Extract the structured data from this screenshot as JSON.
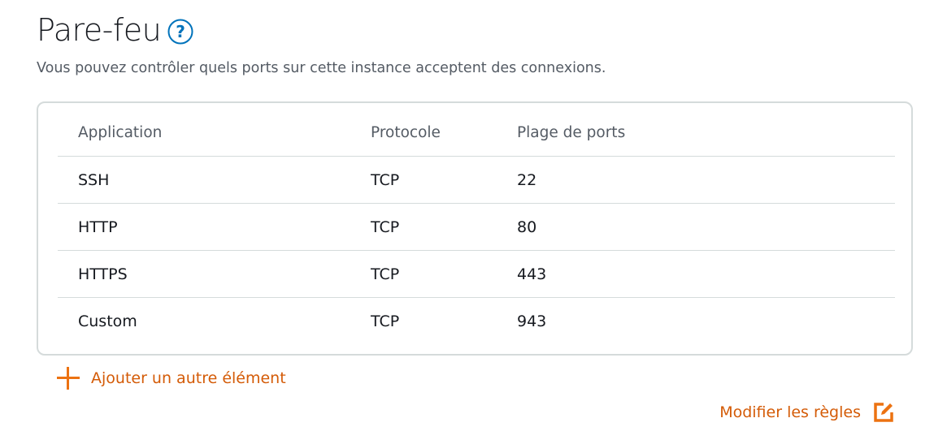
{
  "header": {
    "title": "Pare-feu",
    "subtitle": "Vous pouvez contrôler quels ports sur cette instance acceptent des connexions."
  },
  "table": {
    "columns": [
      "Application",
      "Protocole",
      "Plage de ports"
    ],
    "rows": [
      {
        "application": "SSH",
        "protocol": "TCP",
        "ports": "22"
      },
      {
        "application": "HTTP",
        "protocol": "TCP",
        "ports": "80"
      },
      {
        "application": "HTTPS",
        "protocol": "TCP",
        "ports": "443"
      },
      {
        "application": "Custom",
        "protocol": "TCP",
        "ports": "943"
      }
    ]
  },
  "actions": {
    "add_label": "Ajouter un autre élément",
    "edit_label": "Modifier les règles"
  },
  "icons": {
    "help": "question-circle-icon",
    "add": "plus-icon",
    "edit": "edit-icon"
  },
  "colors": {
    "accent": "#ec7211",
    "link": "#d45b07",
    "help": "#0073bb"
  }
}
